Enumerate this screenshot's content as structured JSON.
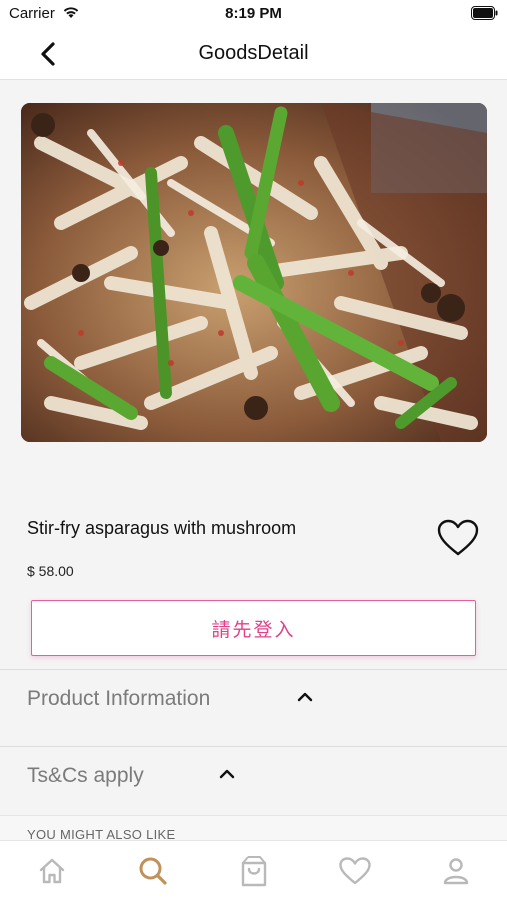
{
  "status_bar": {
    "carrier": "Carrier",
    "time": "8:19 PM"
  },
  "nav": {
    "title": "GoodsDetail",
    "back_icon": "chevron-left-icon"
  },
  "product": {
    "image_description_icon": "food-photo",
    "name": "Stir-fry asparagus with mushroom",
    "price": "$ 58.00",
    "favorite_icon": "heart-outline-icon",
    "login_button_label": "請先登入"
  },
  "accordions": [
    {
      "title": "Product Information",
      "icon": "chevron-up-icon"
    },
    {
      "title": "Ts&Cs apply",
      "icon": "chevron-up-icon"
    }
  ],
  "recommendations": {
    "section_label": "YOU MIGHT ALSO LIKE"
  },
  "tab_bar": {
    "items": [
      {
        "icon": "home-icon",
        "active": false
      },
      {
        "icon": "search-icon",
        "active": true
      },
      {
        "icon": "shopping-bag-icon",
        "active": false
      },
      {
        "icon": "heart-icon",
        "active": false
      },
      {
        "icon": "profile-icon",
        "active": false
      }
    ],
    "active_color": "#c0925a",
    "inactive_color": "#b9b9b9"
  },
  "colors": {
    "accent_pink": "#e0418a"
  }
}
